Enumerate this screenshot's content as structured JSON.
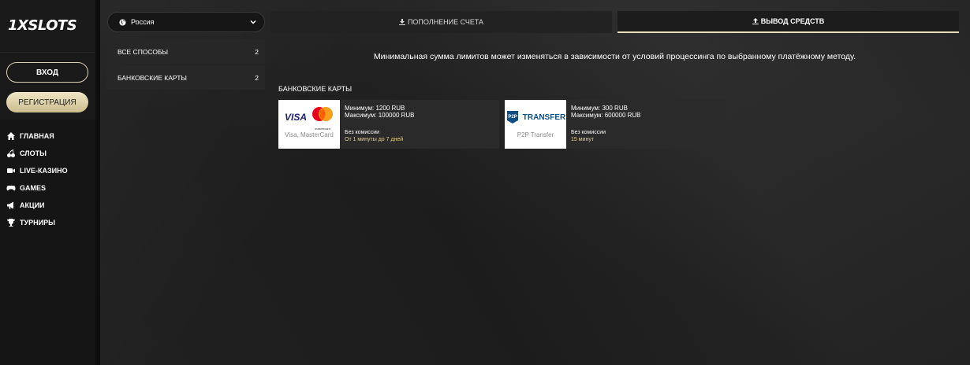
{
  "sidebar": {
    "logo": "1XSLOTS",
    "login_label": "ВХОД",
    "register_label": "РЕГИСТРАЦИЯ",
    "nav": [
      {
        "label": "ГЛАВНАЯ",
        "icon": "home-icon"
      },
      {
        "label": "СЛОТЫ",
        "icon": "cherries-icon"
      },
      {
        "label": "LIVE-КАЗИНО",
        "icon": "live-camera-icon"
      },
      {
        "label": "GAMES",
        "icon": "gamepad-icon"
      },
      {
        "label": "АКЦИИ",
        "icon": "megaphone-icon"
      },
      {
        "label": "ТУРНИРЫ",
        "icon": "trophy-icon"
      }
    ]
  },
  "country": {
    "label": "Россия",
    "icon": "globe-icon"
  },
  "methods": [
    {
      "label": "ВСЕ СПОСОБЫ",
      "count": "2"
    },
    {
      "label": "БАНКОВСКИЕ КАРТЫ",
      "count": "2"
    }
  ],
  "tabs": {
    "deposit": "ПОПОЛНЕНИЕ СЧЕТА",
    "withdraw": "ВЫВОД СРЕДСТВ"
  },
  "notice": "Минимальная сумма лимитов может изменяться в зависимости от условий процессинга по выбранному платёжному методу.",
  "section_title": "БАНКОВСКИЕ КАРТЫ",
  "cards": [
    {
      "logo_text": "VISA",
      "caption": "Visa, MasterCard",
      "min": "Минимум: 1200 RUB",
      "max": "Максимум: 100000 RUB",
      "fee": "Без комиссии",
      "time": "От 1 минуты до 7 дней",
      "mc_text": "mastercard"
    },
    {
      "logo_text": "TRANSFER",
      "badge_text": "P2P",
      "caption": "P2P Transfer",
      "min": "Минимум: 300 RUB",
      "max": "Максимум: 600000 RUB",
      "fee": "Без комиссии",
      "time": "15 минут"
    }
  ],
  "colors": {
    "accent": "#e9dfb8",
    "time": "#e3cf8b"
  }
}
